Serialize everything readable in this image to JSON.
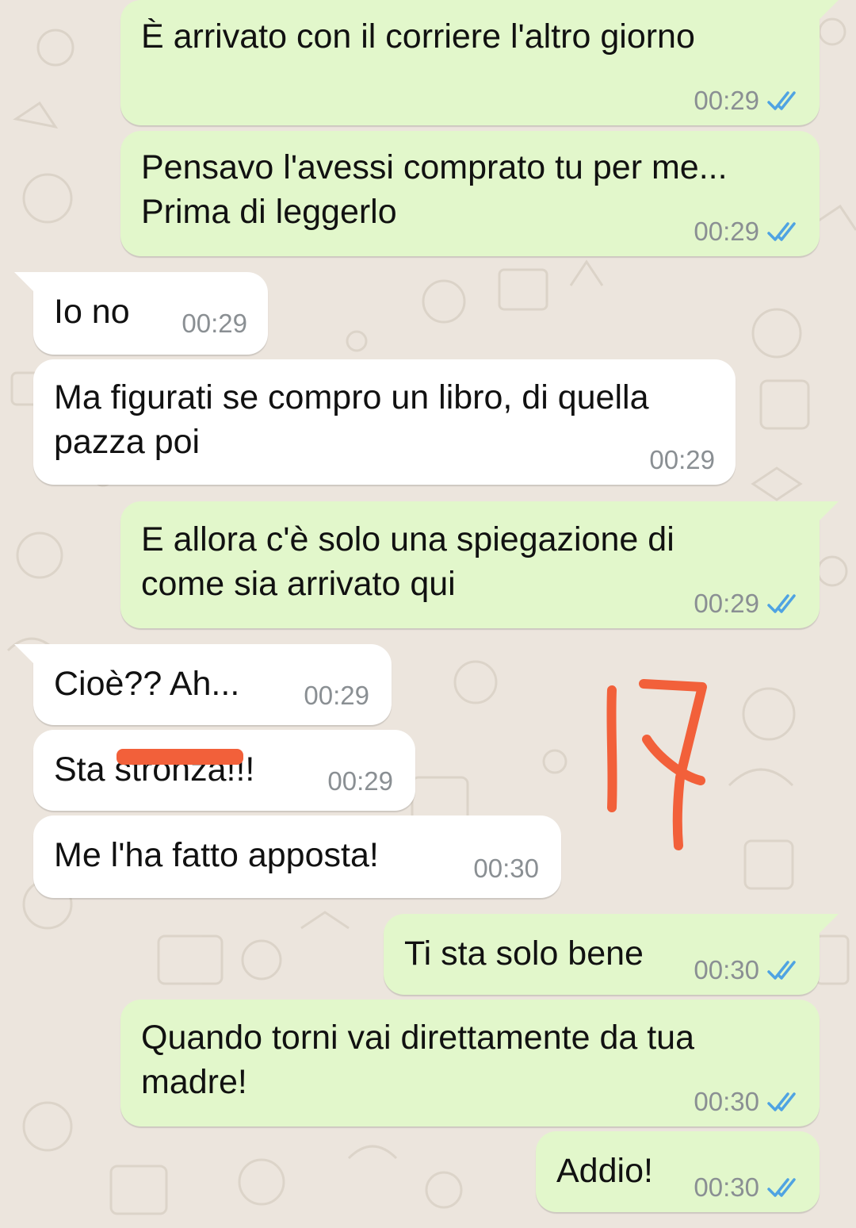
{
  "colors": {
    "background": "#ece5dd",
    "outgoing_bubble": "#e2f7cb",
    "incoming_bubble": "#ffffff",
    "read_ticks": "#4fa3e2",
    "annotation": "#f2603a"
  },
  "annotation": {
    "text": "17",
    "style": "hand-drawn red"
  },
  "redaction": {
    "note": "part of a word in message 7 is covered by a red stroke"
  },
  "messages": [
    {
      "direction": "out",
      "text": "È arrivato con il corriere l'altro giorno",
      "time": "00:29",
      "status": "read"
    },
    {
      "direction": "out",
      "text": "Pensavo l'avessi comprato tu per me...\nPrima di leggerlo",
      "time": "00:29",
      "status": "read"
    },
    {
      "direction": "in",
      "text": "Io no",
      "time": "00:29"
    },
    {
      "direction": "in",
      "text": "Ma figurati se compro un libro, di quella\npazza poi",
      "time": "00:29"
    },
    {
      "direction": "out",
      "text": "E allora c'è solo una spiegazione di\ncome sia arrivato qui",
      "time": "00:29",
      "status": "read"
    },
    {
      "direction": "in",
      "text": "Cioè?? Ah...",
      "time": "00:29"
    },
    {
      "direction": "in",
      "text": "Sta stronza!!!",
      "time": "00:29"
    },
    {
      "direction": "in",
      "text": "Me l'ha fatto apposta!",
      "time": "00:30"
    },
    {
      "direction": "out",
      "text": "Ti sta solo bene",
      "time": "00:30",
      "status": "read"
    },
    {
      "direction": "out",
      "text": "Quando torni vai direttamente da tua\nmadre!",
      "time": "00:30",
      "status": "read"
    },
    {
      "direction": "out",
      "text": "Addio!",
      "time": "00:30",
      "status": "read"
    }
  ]
}
